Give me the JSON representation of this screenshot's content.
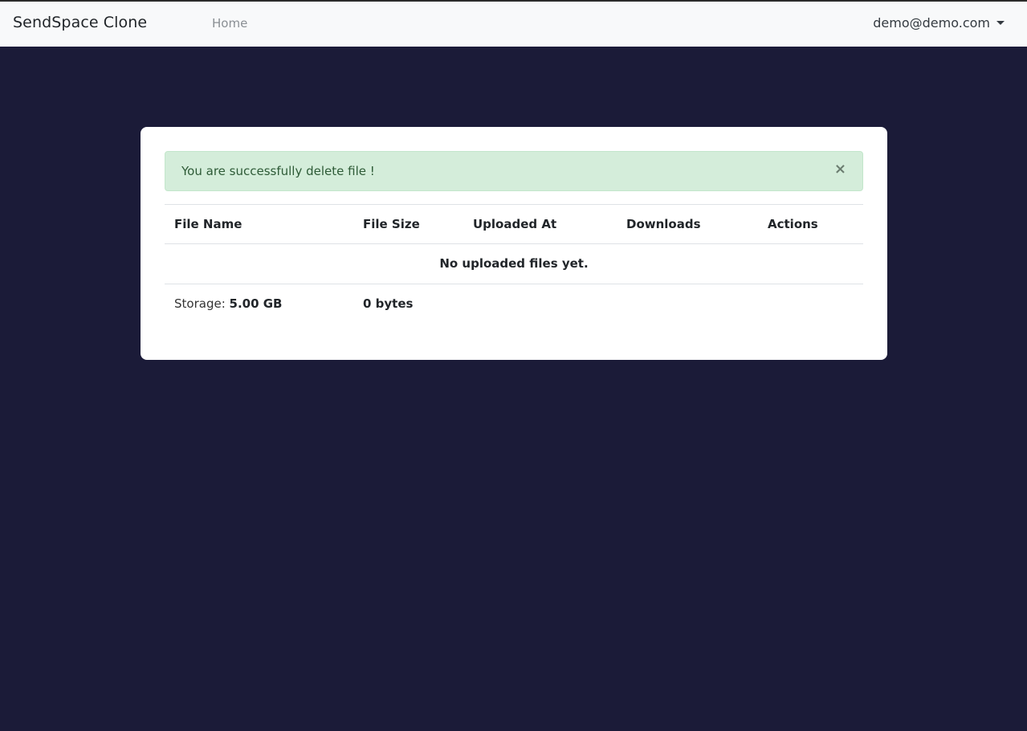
{
  "navbar": {
    "brand": "SendSpace Clone",
    "home_link": "Home",
    "user_email": "demo@demo.com"
  },
  "alert": {
    "message": "You are successfully delete file !",
    "close_symbol": "×"
  },
  "table": {
    "headers": [
      "File Name",
      "File Size",
      "Uploaded At",
      "Downloads",
      "Actions"
    ],
    "empty_message": "No uploaded files yet."
  },
  "storage": {
    "label": "Storage:",
    "total": "5.00 GB",
    "used": "0 bytes"
  },
  "colors": {
    "background": "#1b1b38",
    "navbar": "#f8f9fa",
    "alert_bg": "#d4edda",
    "alert_text": "#2e5b37"
  }
}
